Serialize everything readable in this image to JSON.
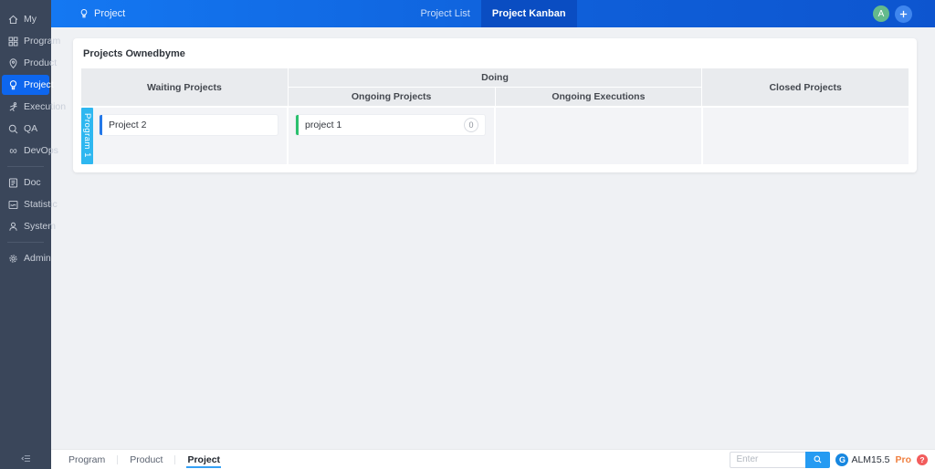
{
  "topbar": {
    "title": "Project",
    "tabs": [
      {
        "label": "Project List",
        "active": false
      },
      {
        "label": "Project Kanban",
        "active": true
      }
    ],
    "avatar_letter": "A"
  },
  "sidebar": {
    "items": [
      {
        "label": "My"
      },
      {
        "label": "Program"
      },
      {
        "label": "Product"
      },
      {
        "label": "Project",
        "active": true
      },
      {
        "label": "Execution"
      },
      {
        "label": "QA"
      },
      {
        "label": "DevOps"
      },
      {
        "label": "Doc"
      },
      {
        "label": "Statistic"
      },
      {
        "label": "System"
      },
      {
        "label": "Admin"
      }
    ]
  },
  "kanban": {
    "title": "Projects Ownedbyme",
    "headers": {
      "waiting": "Waiting Projects",
      "doing": "Doing",
      "ongoing_projects": "Ongoing Projects",
      "ongoing_executions": "Ongoing Executions",
      "closed": "Closed Projects"
    },
    "lane": {
      "name": "Program 1",
      "waiting_card": {
        "title": "Project 2"
      },
      "ongoing_card": {
        "title": "project 1",
        "badge": "0"
      }
    }
  },
  "bottombar": {
    "tabs": [
      {
        "label": "Program",
        "active": false
      },
      {
        "label": "Product",
        "active": false
      },
      {
        "label": "Project",
        "active": true
      }
    ],
    "search": {
      "placeholder": "Enter"
    },
    "brand": "ALM15.5",
    "edition": "Pro",
    "help_glyph": "?",
    "logo_glyph": "G"
  },
  "colors": {
    "sidebar_bg": "#3a465a",
    "topbar_blue": "#1478f2",
    "active_item_blue": "#0d66ee",
    "active_tab_blue": "#0a4dc2",
    "lane_strip_cyan": "#2eb7f0",
    "card_accent_blue": "#2478e8",
    "card_accent_green": "#2bc06e",
    "avatar_green": "#64ba8c",
    "search_btn_blue": "#259bf2",
    "edition_orange": "#f08040",
    "help_red": "#f25c5c"
  }
}
